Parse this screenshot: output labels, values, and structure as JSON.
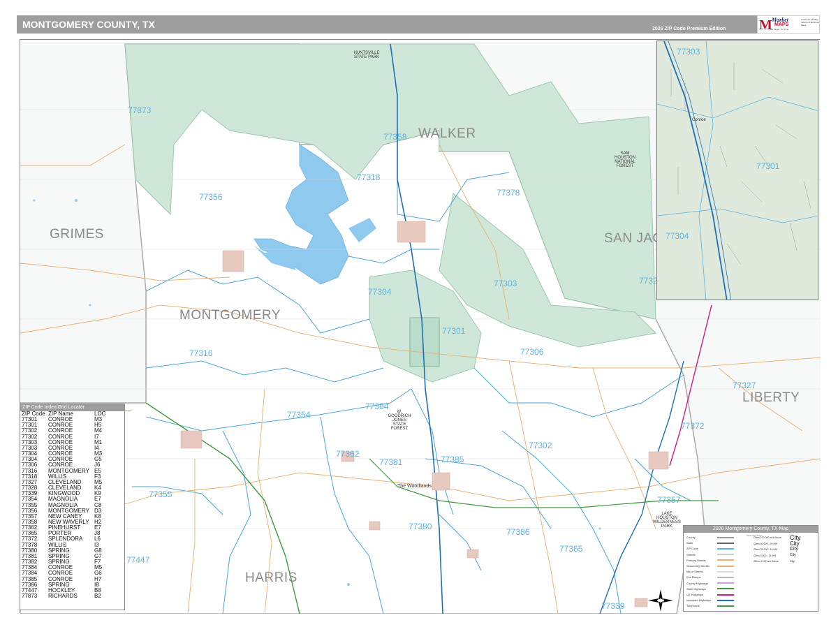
{
  "header": {
    "title": "MONTGOMERY COUNTY, TX",
    "edition": "2026 ZIP Code Premium Edition",
    "logo": {
      "word": "Market",
      "brand": "MAPS",
      "tagline": "On Target. On Time.",
      "small": "America's Leading Source of Business Maps"
    }
  },
  "map": {
    "colors": {
      "forest": "#cfe7d9",
      "forest_border": "#9cc7ae",
      "water": "#8fc9ee",
      "zip_boundary": "#4aa6d8",
      "county_boundary": "#aaaaaa",
      "urban": "#e8c9c0",
      "road_orange": "#e8b070",
      "road_grey": "#c0c0c0",
      "highway_blue": "#1f6fb7",
      "highway_green": "#3c9a3c",
      "highway_magenta": "#d0197a",
      "zip_label": "#5bb4e0",
      "county_label": "#8a8a8a"
    },
    "counties": [
      {
        "name": "WALKER"
      },
      {
        "name": "GRIMES"
      },
      {
        "name": "MONTGOMERY"
      },
      {
        "name": "SAN JAC"
      },
      {
        "name": "LIBERTY"
      },
      {
        "name": "HARRIS"
      }
    ],
    "zip_labels": [
      "77873",
      "77358",
      "77318",
      "77356",
      "77378",
      "77303",
      "77304",
      "77301",
      "77306",
      "77316",
      "77327",
      "77384",
      "77354",
      "77302",
      "77372",
      "77362",
      "77381",
      "77385",
      "77355",
      "77357",
      "77380",
      "77386",
      "77365",
      "77447",
      "77339",
      "7732"
    ],
    "places": {
      "woodlands": "The Woodlands",
      "conroe": "Conroe",
      "sam_houston": "SAM HOUSTON NATIONAL FOREST",
      "huntsville": "HUNTSVILLE STATE PARK",
      "lake_houston": "LAKE HOUSTON WILDERNESS PARK",
      "state_forest": "W. GOODRICH JONES STATE FOREST"
    }
  },
  "inset": {
    "zip_labels": [
      "77303",
      "77301",
      "77304"
    ],
    "place": "Conroe"
  },
  "zip_table": {
    "title": "ZIP Code Index/Grid Locator",
    "headers": [
      "ZIP Code",
      "ZIP Name",
      "LOC"
    ],
    "rows": [
      [
        "77301",
        "CONROE",
        "M3"
      ],
      [
        "77301",
        "CONROE",
        "H5"
      ],
      [
        "77302",
        "CONROE",
        "M4"
      ],
      [
        "77302",
        "CONROE",
        "I7"
      ],
      [
        "77303",
        "CONROE",
        "M1"
      ],
      [
        "77303",
        "CONROE",
        "I4"
      ],
      [
        "77304",
        "CONROE",
        "M3"
      ],
      [
        "77304",
        "CONROE",
        "G5"
      ],
      [
        "77306",
        "CONROE",
        "J6"
      ],
      [
        "77316",
        "MONTGOMERY",
        "E5"
      ],
      [
        "77318",
        "WILLIS",
        "F3"
      ],
      [
        "77327",
        "CLEVELAND",
        "M5"
      ],
      [
        "77328",
        "CLEVELAND",
        "K4"
      ],
      [
        "77339",
        "KINGWOOD",
        "K9"
      ],
      [
        "77354",
        "MAGNOLIA",
        "E7"
      ],
      [
        "77355",
        "MAGNOLIA",
        "C8"
      ],
      [
        "77356",
        "MONTGOMERY",
        "D3"
      ],
      [
        "77357",
        "NEW CANEY",
        "K8"
      ],
      [
        "77358",
        "NEW WAVERLY",
        "H2"
      ],
      [
        "77362",
        "PINEHURST",
        "E7"
      ],
      [
        "77365",
        "PORTER",
        "J8"
      ],
      [
        "77372",
        "SPLENDORA",
        "L6"
      ],
      [
        "77378",
        "WILLIS",
        "I3"
      ],
      [
        "77380",
        "SPRING",
        "G8"
      ],
      [
        "77381",
        "SPRING",
        "G7"
      ],
      [
        "77382",
        "SPRING",
        "F7"
      ],
      [
        "77384",
        "CONROE",
        "M5"
      ],
      [
        "77384",
        "CONROE",
        "G6"
      ],
      [
        "77385",
        "CONROE",
        "H7"
      ],
      [
        "77386",
        "SPRING",
        "I8"
      ],
      [
        "77447",
        "HOCKLEY",
        "B8"
      ],
      [
        "77873",
        "RICHARDS",
        "B2"
      ]
    ]
  },
  "legend": {
    "title": "2026 Montgomery County, TX Map",
    "subtitle": "Cities and Towns",
    "items": [
      "County",
      "State",
      "ZIP Code",
      "Streets",
      "Primary Streets",
      "Secondary Streets",
      "Minor Streets",
      "Exit Ramps",
      "County Highways",
      "State Highways",
      "US Highways",
      "Interstate Highways",
      "Toll Roads"
    ],
    "cities": [
      {
        "pop": "Cities 100,000 and Above",
        "name": "City"
      },
      {
        "pop": "Cities 50,000 - 99,999",
        "name": "City"
      },
      {
        "pop": "Cities 25,000 - 49,999",
        "name": "City"
      },
      {
        "pop": "Cities 5,000 - 24,999",
        "name": "City"
      },
      {
        "pop": "Cities 4,999 and Below",
        "name": "City"
      }
    ]
  }
}
